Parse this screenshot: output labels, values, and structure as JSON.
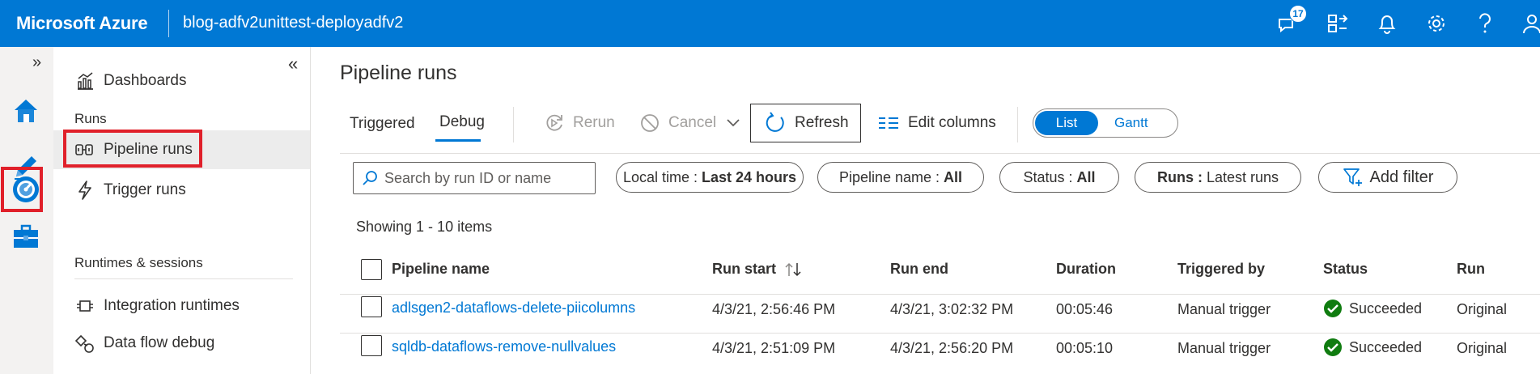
{
  "topbar": {
    "brand": "Microsoft Azure",
    "factory_name": "blog-adfv2unittest-deployadfv2",
    "notification_count": "17",
    "icons": [
      "feedback-icon",
      "directory-switch-icon",
      "bell-icon",
      "gear-icon",
      "help-icon",
      "user-icon"
    ],
    "background_color": "#0078d4"
  },
  "rail": {
    "expand": "»",
    "items": [
      "home-icon",
      "author-pencil-icon",
      "monitor-gauge-icon",
      "manage-toolbox-icon"
    ],
    "selected": "monitor-gauge-icon"
  },
  "nav": {
    "collapse": "«",
    "dashboards": "Dashboards",
    "runs_header": "Runs",
    "pipeline_runs": "Pipeline runs",
    "trigger_runs": "Trigger runs",
    "runtimes_header": "Runtimes & sessions",
    "integration_runtimes": "Integration runtimes",
    "data_flow_debug": "Data flow debug"
  },
  "main": {
    "title": "Pipeline runs",
    "tabs": [
      "Triggered",
      "Debug"
    ],
    "active_tab": "Debug",
    "toolbar": {
      "rerun": "Rerun",
      "cancel": "Cancel",
      "refresh": "Refresh",
      "edit_columns": "Edit columns"
    },
    "view_toggle": {
      "list": "List",
      "gantt": "Gantt",
      "selected": "List"
    },
    "filters": {
      "search_placeholder": "Search by run ID or name",
      "local_time_label": "Local time : ",
      "local_time_value": "Last 24 hours",
      "pipeline_name_label": "Pipeline name : ",
      "pipeline_name_value": "All",
      "status_label": "Status : ",
      "status_value": "All",
      "runs_label": "Runs : ",
      "runs_value": "Latest runs",
      "add_filter": "Add filter"
    },
    "showing": "Showing 1 - 10 items",
    "columns": [
      "Pipeline name",
      "Run start",
      "Run end",
      "Duration",
      "Triggered by",
      "Status",
      "Run"
    ],
    "rows": [
      {
        "pipeline": "adlsgen2-dataflows-delete-piicolumns",
        "run_start": "4/3/21, 2:56:46 PM",
        "run_end": "4/3/21, 3:02:32 PM",
        "duration": "00:05:46",
        "triggered_by": "Manual trigger",
        "status": "Succeeded",
        "run": "Original"
      },
      {
        "pipeline": "sqldb-dataflows-remove-nullvalues",
        "run_start": "4/3/21, 2:51:09 PM",
        "run_end": "4/3/21, 2:56:20 PM",
        "duration": "00:05:10",
        "triggered_by": "Manual trigger",
        "status": "Succeeded",
        "run": "Original"
      }
    ],
    "accent_color": "#0078d4",
    "success_color": "#107c10",
    "highlight_color": "#e0202a"
  }
}
